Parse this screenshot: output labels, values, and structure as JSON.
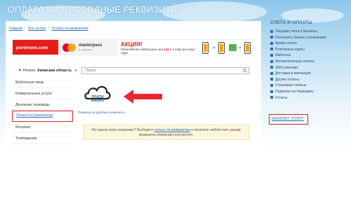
{
  "page": {
    "title": "ОПЛАТА НА СВОБОДНЫЕ РЕКВИЗИТЫ"
  },
  "breadcrumb": {
    "items": [
      "Главная",
      "Все услуги",
      "Оплата по реквизитам"
    ],
    "separator": "/"
  },
  "banner": {
    "portmone": "portmone.com",
    "masterpass": "masterpass",
    "masterpass_sub": "by mastercard",
    "promo_title": "АКЦИЯ!",
    "promo_text_part1": "Пополняй все мобильные за",
    "promo_text_bold": "1 грн",
    "promo_text_part2": "в 1 клик до конца года!",
    "colors": {
      "portmone_red": "#e51d1a",
      "mc_red": "#eb001b",
      "mc_orange": "#f79e1b"
    }
  },
  "region": {
    "label": "Регион:",
    "value": "Киевская область",
    "dropdown_icon": "chevron-down-icon"
  },
  "search": {
    "placeholder": "Поиск",
    "icon": "search-icon"
  },
  "sidebar": {
    "items": [
      {
        "label": "Мобильная связь"
      },
      {
        "label": "Коммунальные услуги"
      },
      {
        "label": "Денежные переводы"
      },
      {
        "label": "Оплата по реквизитам"
      },
      {
        "label": "Интернет"
      },
      {
        "label": "Телевидение"
      }
    ],
    "active_index": 3
  },
  "content": {
    "logo_text_line1": "ПЛАТИ",
    "logo_text_line2": "ФАЙНО",
    "logo_link": "Перевод на удобные реквизиты",
    "notice_part1": "Не нашли свою компанию? Выберите",
    "notice_link": "оплату по реквизитам",
    "notice_part2": "и оплатите любой счет, указав реквизиты компании-получателя."
  },
  "right_panel": {
    "title": "СЧЕТА И ОПЛАТЫ",
    "items": [
      {
        "label": "Текущие счета и балансы"
      },
      {
        "label": "Пополнить баланс в компаниях"
      },
      {
        "label": "Архив счетов"
      },
      {
        "label": "Платёжные карты"
      },
      {
        "label": "Шаблоны"
      },
      {
        "label": "Автоматическая оплата"
      },
      {
        "label": "SMS-платежи"
      },
      {
        "label": "Доставка в квитанций"
      },
      {
        "label": "Другие оплаты"
      },
      {
        "label": "Страховые полисы"
      },
      {
        "label": "Подписки на периодику"
      },
      {
        "label": "Отчеты"
      }
    ],
    "catalog_label": "КАТАЛОГ УСЛУГ"
  }
}
